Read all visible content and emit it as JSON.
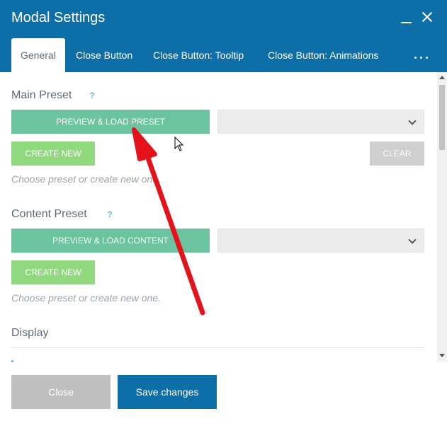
{
  "dialog": {
    "title": "Modal Settings"
  },
  "window_controls": {
    "minimize_icon": "minimize-icon",
    "close_icon": "close-icon"
  },
  "tabs": [
    {
      "label": "General",
      "active": true
    },
    {
      "label": "Close Button",
      "active": false
    },
    {
      "label": "Close Button: Tooltip",
      "active": false
    },
    {
      "label": "Close Button: Animations",
      "active": false
    }
  ],
  "tabs_more_icon": "more-horizontal-icon",
  "main_preset": {
    "title": "Main Preset",
    "help": "?",
    "preview_label": "PREVIEW & LOAD PRESET",
    "select_value": "",
    "create_label": "CREATE NEW",
    "clear_label": "CLEAR",
    "hint": "Choose preset or create new one."
  },
  "content_preset": {
    "title": "Content Preset",
    "help": "?",
    "preview_label": "PREVIEW & LOAD CONTENT",
    "select_value": "",
    "create_label": "CREATE NEW",
    "hint": "Choose preset or create new one."
  },
  "display": {
    "title": "Display"
  },
  "footer": {
    "close_label": "Close",
    "save_label": "Save changes"
  },
  "colors": {
    "header": "#0e6fa8",
    "preview_button": "#6cc3a0",
    "create_button": "#90d97f",
    "clear_button": "#cfcfcf",
    "help_icon": "#5bc0de",
    "annotation_arrow": "#e3121b"
  }
}
